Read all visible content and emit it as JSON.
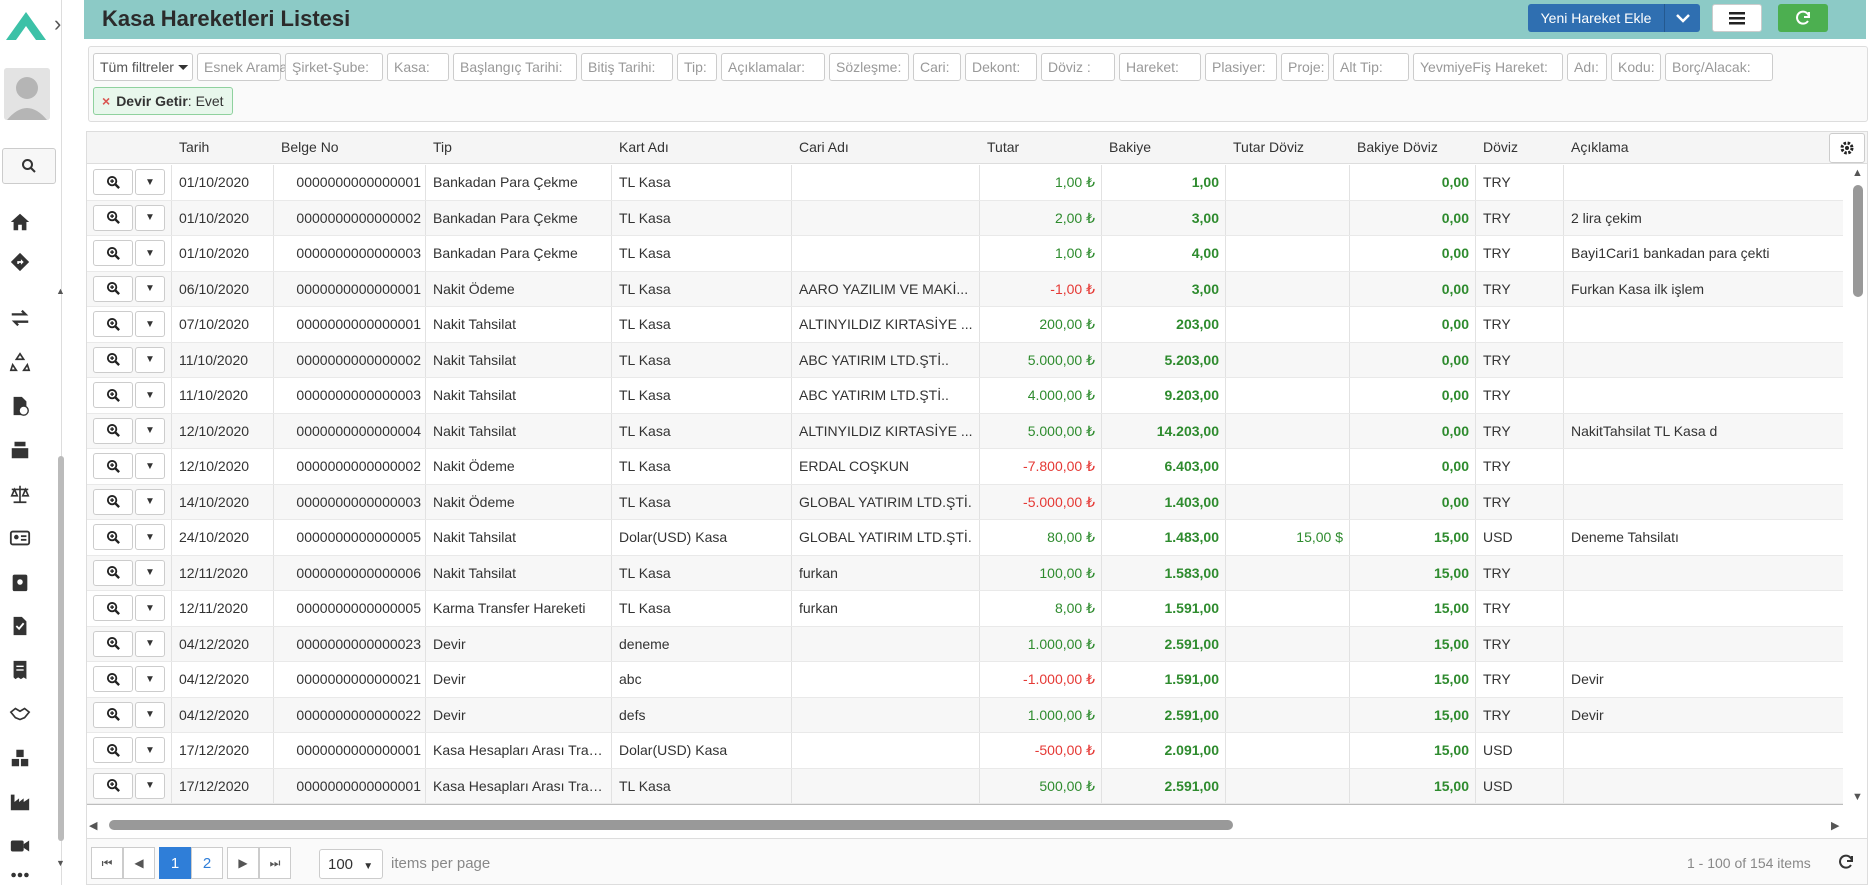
{
  "header": {
    "title": "Kasa Hareketleri Listesi",
    "new_button": "Yeni Hareket Ekle"
  },
  "filters": {
    "all_filters": "Tüm filtreler",
    "chips": [
      "Esnek Arama:",
      "Şirket-Şube:",
      "Kasa:",
      "Başlangıç Tarihi:",
      "Bitiş Tarihi:",
      "Tip:",
      "Açıklamalar:",
      "Sözleşme:",
      "Cari:",
      "Dekont:",
      "Döviz :",
      "Hareket:",
      "Plasiyer:",
      "Proje:",
      "Alt Tip:",
      "YevmiyeFiş Hareket:",
      "Adı:",
      "Kodu:",
      "Borç/Alacak:"
    ],
    "active_name": "Devir Getir",
    "active_value": "Evet"
  },
  "table": {
    "columns": [
      "Tarih",
      "Belge No",
      "Tip",
      "Kart Adı",
      "Cari Adı",
      "Tutar",
      "Bakiye",
      "Tutar Döviz",
      "Bakiye Döviz",
      "Döviz",
      "Açıklama"
    ],
    "rows": [
      {
        "tarih": "01/10/2020",
        "belge": "0000000000000001",
        "tip": "Bankadan Para Çekme",
        "kart": "TL Kasa",
        "cari": "",
        "tutar": "1,00 ₺",
        "tutar_neg": false,
        "bakiye": "1,00",
        "tutar_doviz": "",
        "bakiye_doviz": "0,00",
        "doviz": "TRY",
        "aciklama": ""
      },
      {
        "tarih": "01/10/2020",
        "belge": "0000000000000002",
        "tip": "Bankadan Para Çekme",
        "kart": "TL Kasa",
        "cari": "",
        "tutar": "2,00 ₺",
        "tutar_neg": false,
        "bakiye": "3,00",
        "tutar_doviz": "",
        "bakiye_doviz": "0,00",
        "doviz": "TRY",
        "aciklama": "2 lira çekim"
      },
      {
        "tarih": "01/10/2020",
        "belge": "0000000000000003",
        "tip": "Bankadan Para Çekme",
        "kart": "TL Kasa",
        "cari": "",
        "tutar": "1,00 ₺",
        "tutar_neg": false,
        "bakiye": "4,00",
        "tutar_doviz": "",
        "bakiye_doviz": "0,00",
        "doviz": "TRY",
        "aciklama": "Bayi1Cari1 bankadan para çekti"
      },
      {
        "tarih": "06/10/2020",
        "belge": "0000000000000001",
        "tip": "Nakit Ödeme",
        "kart": "TL Kasa",
        "cari": "AARO YAZILIM VE MAKİ...",
        "tutar": "-1,00 ₺",
        "tutar_neg": true,
        "bakiye": "3,00",
        "tutar_doviz": "",
        "bakiye_doviz": "0,00",
        "doviz": "TRY",
        "aciklama": "Furkan Kasa ilk işlem"
      },
      {
        "tarih": "07/10/2020",
        "belge": "0000000000000001",
        "tip": "Nakit Tahsilat",
        "kart": "TL Kasa",
        "cari": "ALTINYILDIZ KIRTASİYE ...",
        "tutar": "200,00 ₺",
        "tutar_neg": false,
        "bakiye": "203,00",
        "tutar_doviz": "",
        "bakiye_doviz": "0,00",
        "doviz": "TRY",
        "aciklama": ""
      },
      {
        "tarih": "11/10/2020",
        "belge": "0000000000000002",
        "tip": "Nakit Tahsilat",
        "kart": "TL Kasa",
        "cari": "ABC YATIRIM LTD.ŞTİ..",
        "tutar": "5.000,00 ₺",
        "tutar_neg": false,
        "bakiye": "5.203,00",
        "tutar_doviz": "",
        "bakiye_doviz": "0,00",
        "doviz": "TRY",
        "aciklama": ""
      },
      {
        "tarih": "11/10/2020",
        "belge": "0000000000000003",
        "tip": "Nakit Tahsilat",
        "kart": "TL Kasa",
        "cari": "ABC YATIRIM LTD.ŞTİ..",
        "tutar": "4.000,00 ₺",
        "tutar_neg": false,
        "bakiye": "9.203,00",
        "tutar_doviz": "",
        "bakiye_doviz": "0,00",
        "doviz": "TRY",
        "aciklama": ""
      },
      {
        "tarih": "12/10/2020",
        "belge": "0000000000000004",
        "tip": "Nakit Tahsilat",
        "kart": "TL Kasa",
        "cari": "ALTINYILDIZ KIRTASİYE ...",
        "tutar": "5.000,00 ₺",
        "tutar_neg": false,
        "bakiye": "14.203,00",
        "tutar_doviz": "",
        "bakiye_doviz": "0,00",
        "doviz": "TRY",
        "aciklama": "NakitTahsilat TL Kasa d"
      },
      {
        "tarih": "12/10/2020",
        "belge": "0000000000000002",
        "tip": "Nakit Ödeme",
        "kart": "TL Kasa",
        "cari": "ERDAL COŞKUN",
        "tutar": "-7.800,00 ₺",
        "tutar_neg": true,
        "bakiye": "6.403,00",
        "tutar_doviz": "",
        "bakiye_doviz": "0,00",
        "doviz": "TRY",
        "aciklama": ""
      },
      {
        "tarih": "14/10/2020",
        "belge": "0000000000000003",
        "tip": "Nakit Ödeme",
        "kart": "TL Kasa",
        "cari": "GLOBAL YATIRIM LTD.ŞTİ.",
        "tutar": "-5.000,00 ₺",
        "tutar_neg": true,
        "bakiye": "1.403,00",
        "tutar_doviz": "",
        "bakiye_doviz": "0,00",
        "doviz": "TRY",
        "aciklama": ""
      },
      {
        "tarih": "24/10/2020",
        "belge": "0000000000000005",
        "tip": "Nakit Tahsilat",
        "kart": "Dolar(USD) Kasa",
        "cari": "GLOBAL YATIRIM LTD.ŞTİ.",
        "tutar": "80,00 ₺",
        "tutar_neg": false,
        "bakiye": "1.483,00",
        "tutar_doviz": "15,00 $",
        "bakiye_doviz": "15,00",
        "doviz": "USD",
        "aciklama": "Deneme Tahsilatı"
      },
      {
        "tarih": "12/11/2020",
        "belge": "0000000000000006",
        "tip": "Nakit Tahsilat",
        "kart": "TL Kasa",
        "cari": "furkan",
        "tutar": "100,00 ₺",
        "tutar_neg": false,
        "bakiye": "1.583,00",
        "tutar_doviz": "",
        "bakiye_doviz": "15,00",
        "doviz": "TRY",
        "aciklama": ""
      },
      {
        "tarih": "12/11/2020",
        "belge": "0000000000000005",
        "tip": "Karma Transfer Hareketi",
        "kart": "TL Kasa",
        "cari": "furkan",
        "tutar": "8,00 ₺",
        "tutar_neg": false,
        "bakiye": "1.591,00",
        "tutar_doviz": "",
        "bakiye_doviz": "15,00",
        "doviz": "TRY",
        "aciklama": ""
      },
      {
        "tarih": "04/12/2020",
        "belge": "0000000000000023",
        "tip": "Devir",
        "kart": "deneme",
        "cari": "",
        "tutar": "1.000,00 ₺",
        "tutar_neg": false,
        "bakiye": "2.591,00",
        "tutar_doviz": "",
        "bakiye_doviz": "15,00",
        "doviz": "TRY",
        "aciklama": ""
      },
      {
        "tarih": "04/12/2020",
        "belge": "0000000000000021",
        "tip": "Devir",
        "kart": "abc",
        "cari": "",
        "tutar": "-1.000,00 ₺",
        "tutar_neg": true,
        "bakiye": "1.591,00",
        "tutar_doviz": "",
        "bakiye_doviz": "15,00",
        "doviz": "TRY",
        "aciklama": "Devir"
      },
      {
        "tarih": "04/12/2020",
        "belge": "0000000000000022",
        "tip": "Devir",
        "kart": "defs",
        "cari": "",
        "tutar": "1.000,00 ₺",
        "tutar_neg": false,
        "bakiye": "2.591,00",
        "tutar_doviz": "",
        "bakiye_doviz": "15,00",
        "doviz": "TRY",
        "aciklama": "Devir"
      },
      {
        "tarih": "17/12/2020",
        "belge": "0000000000000001",
        "tip": "Kasa Hesapları Arası Tran...",
        "kart": "Dolar(USD) Kasa",
        "cari": "",
        "tutar": "-500,00 ₺",
        "tutar_neg": true,
        "bakiye": "2.091,00",
        "tutar_doviz": "",
        "bakiye_doviz": "15,00",
        "doviz": "USD",
        "aciklama": ""
      },
      {
        "tarih": "17/12/2020",
        "belge": "0000000000000001",
        "tip": "Kasa Hesapları Arası Tran...",
        "kart": "TL Kasa",
        "cari": "",
        "tutar": "500,00 ₺",
        "tutar_neg": false,
        "bakiye": "2.591,00",
        "tutar_doviz": "",
        "bakiye_doviz": "15,00",
        "doviz": "USD",
        "aciklama": ""
      }
    ]
  },
  "pager": {
    "pages": [
      "1",
      "2"
    ],
    "current_page": "1",
    "page_size": "100",
    "page_size_label": "items per page",
    "info": "1 - 100 of 154 items"
  },
  "colors": {
    "header_bg": "#8ccac6",
    "primary": "#2f6fb1",
    "refresh": "#4caf50",
    "positive": "#2e8b2e",
    "negative": "#e53935",
    "logo": "#3cc1a7"
  },
  "icons": {
    "sidebar": [
      "home-icon",
      "directions-icon",
      "transfer-icon",
      "recycle-icon",
      "file-check-icon",
      "cash-register-icon",
      "balance-scale-icon",
      "id-card-icon",
      "clipboard-user-icon",
      "file-invoice-icon",
      "receipt-icon",
      "handshake-icon",
      "boxes-icon",
      "industry-icon",
      "video-icon",
      "more-icon"
    ]
  }
}
